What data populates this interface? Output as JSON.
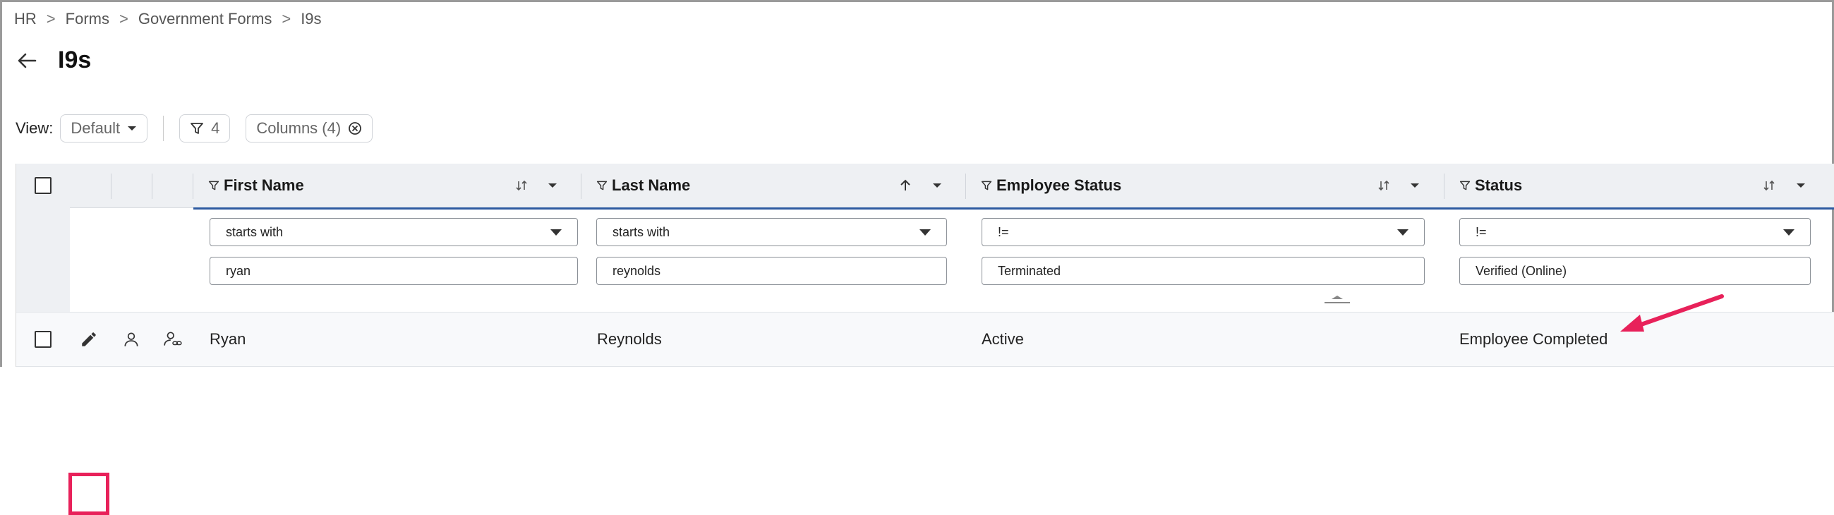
{
  "breadcrumb": [
    "HR",
    "Forms",
    "Government Forms",
    "I9s"
  ],
  "page": {
    "title": "I9s"
  },
  "toolbar": {
    "view_label": "View:",
    "view_value": "Default",
    "filter_count": "4",
    "columns_label": "Columns (4)"
  },
  "columns": [
    {
      "label": "First Name",
      "sort": "none",
      "filter_op": "starts with",
      "filter_value": "ryan"
    },
    {
      "label": "Last Name",
      "sort": "ascending",
      "filter_op": "starts with",
      "filter_value": "reynolds"
    },
    {
      "label": "Employee Status",
      "sort": "none",
      "filter_op": "!=",
      "filter_value": "Terminated"
    },
    {
      "label": "Status",
      "sort": "none",
      "filter_op": "!=",
      "filter_value": "Verified (Online)"
    }
  ],
  "rows": [
    {
      "first_name": "Ryan",
      "last_name": "Reynolds",
      "employee_status": "Active",
      "status": "Employee Completed"
    }
  ],
  "icons": {
    "back": "arrow-left-icon",
    "filter": "funnel-icon",
    "sort": "sort-arrows-icon",
    "menu": "caret-down-icon",
    "edit": "pencil-icon",
    "person": "person-icon",
    "link_person": "person-link-icon"
  },
  "colors": {
    "accent": "#2d5aa0",
    "highlight": "#e8215a",
    "header_bg": "#eef0f3"
  }
}
